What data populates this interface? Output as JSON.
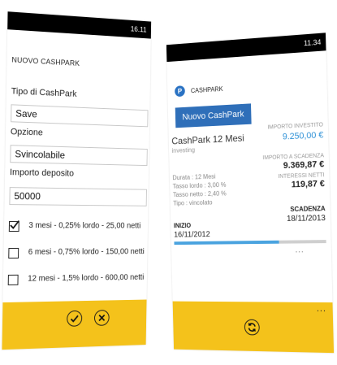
{
  "left_screen": {
    "status_time": "16.11",
    "title": "NUOVO CASHPARK",
    "type_label": "Tipo di CashPark",
    "type_value": "Save",
    "option_label": "Opzione",
    "option_value": "Svincolabile",
    "deposit_label": "Importo deposito",
    "deposit_value": "50000",
    "options": [
      {
        "label": "3 mesi - 0,25% lordo - 25,00 netti",
        "checked": true
      },
      {
        "label": "6 mesi - 0,75% lordo - 150,00 netti",
        "checked": false
      },
      {
        "label": "12 mesi - 1,5% lordo - 600,00 netti",
        "checked": false
      }
    ],
    "appbar": {
      "confirm_icon": "check-icon",
      "cancel_icon": "close-icon"
    }
  },
  "right_screen": {
    "status_time": "11.34",
    "app_logo": "P",
    "app_title": "CASHPARK",
    "new_button": "Nuovo CashPark",
    "product_name": "CashPark 12 Mesi",
    "product_sub": "investing",
    "invest_label": "IMPORTO INVESTITO",
    "invest_value": "9.250,00  €",
    "maturity_label": "IMPORTO A SCADENZA",
    "maturity_value": "9.369,87  €",
    "interest_label": "INTERESSI NETTI",
    "interest_value": "119,87  €",
    "details": [
      "Durata : 12 Mesi",
      "Tasso lordo : 3,00 %",
      "Tasso netto : 2,40 %",
      "Tipo : vincolato"
    ],
    "scadenza_label": "SCADENZA",
    "scadenza_value": "18/11/2013",
    "inizio_label": "INIZIO",
    "inizio_value": "16/11/2012",
    "progress": 0.7,
    "more": "...",
    "appbar_more": "...",
    "appbar_icon": "refresh-icon",
    "colors": {
      "accent_blue": "#2f6fb9",
      "value_blue": "#2a8fd6",
      "appbar_yellow": "#f4c21b",
      "progress_blue": "#4aa3df"
    }
  }
}
